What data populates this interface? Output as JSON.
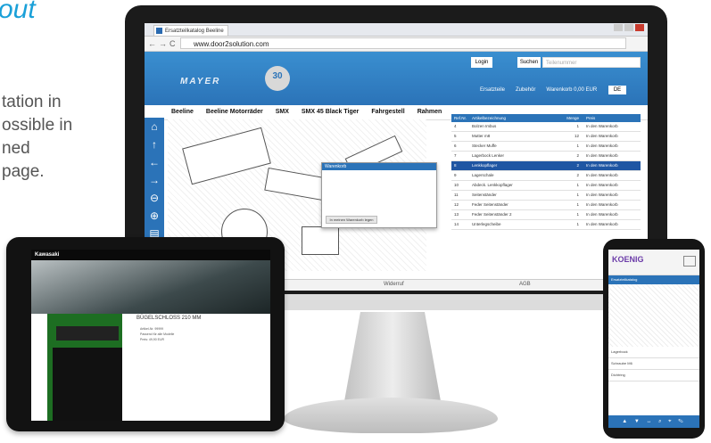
{
  "copy": {
    "heading": "out",
    "lines": [
      "tation in",
      "ossible in",
      "ned",
      "page."
    ]
  },
  "monitor": {
    "tab_title": "Ersatzteilkatalog Beeline",
    "url": "www.door2solution.com",
    "logo": "MAYER",
    "badge": "30",
    "login": "Login",
    "search_button": "Suchen",
    "search_placeholder": "Teilenummer",
    "head_links": [
      "Ersatzteile",
      "Zubehör",
      "Warenkorb 0,00 EUR"
    ],
    "language": "DE",
    "menu": [
      "Beeline",
      "Beeline Motorräder",
      "SMX",
      "SMX 45 Black Tiger",
      "Fahrgestell",
      "Rahmen"
    ],
    "popup": {
      "title": "Warenkorb",
      "button": "In meinen Warenkorb legen"
    },
    "table": {
      "headers": [
        "Ref.Nr.",
        "Artikelbezeichnung",
        "Menge",
        "Preis"
      ],
      "rows": [
        {
          "ref": "4",
          "name": "Bolzen Imbus",
          "qty": "1",
          "price": "In den Warenkorb"
        },
        {
          "ref": "5",
          "name": "Mutter m8",
          "qty": "12",
          "price": "In den Warenkorb"
        },
        {
          "ref": "6",
          "name": "Stecker Muffe",
          "qty": "1",
          "price": "In den Warenkorb"
        },
        {
          "ref": "7",
          "name": "Lagerbock Lenker",
          "qty": "2",
          "price": "In den Warenkorb"
        },
        {
          "ref": "8",
          "name": "Lenkkopflager",
          "qty": "2",
          "price": "In den Warenkorb"
        },
        {
          "ref": "9",
          "name": "Lagerschale",
          "qty": "2",
          "price": "In den Warenkorb"
        },
        {
          "ref": "10",
          "name": "Abdeck. Lenkkopflager",
          "qty": "1",
          "price": "In den Warenkorb"
        },
        {
          "ref": "11",
          "name": "Seitenständer",
          "qty": "1",
          "price": "In den Warenkorb"
        },
        {
          "ref": "12",
          "name": "Feder Seitenständer",
          "qty": "1",
          "price": "In den Warenkorb"
        },
        {
          "ref": "13",
          "name": "Feder Seitenständer 2",
          "qty": "1",
          "price": "In den Warenkorb"
        },
        {
          "ref": "14",
          "name": "Unterlegscheibe",
          "qty": "1",
          "price": "In den Warenkorb"
        }
      ],
      "highlighted_index": 4
    },
    "footer": [
      "Widerruf",
      "AGB"
    ]
  },
  "tablet": {
    "brand": "Kawasaki",
    "title": "BÜGELSCHLOSS 210 MM",
    "lines": [
      "Artikel-Nr. 99999",
      "Passend für alle Modelle",
      "Preis: 49,90 EUR"
    ]
  },
  "phone": {
    "brand": "KOENIG",
    "label": "Ersatzteilkatalog",
    "list": [
      "Lagerbock",
      "Schraube M6",
      "Dichtring"
    ],
    "bottom_bar": "▲ ▼ ↔ ⌕ ⌖ ✎"
  },
  "colors": {
    "accent": "#2b73b8",
    "highlight": "#1f56a3",
    "heading": "#1aa0d8"
  }
}
